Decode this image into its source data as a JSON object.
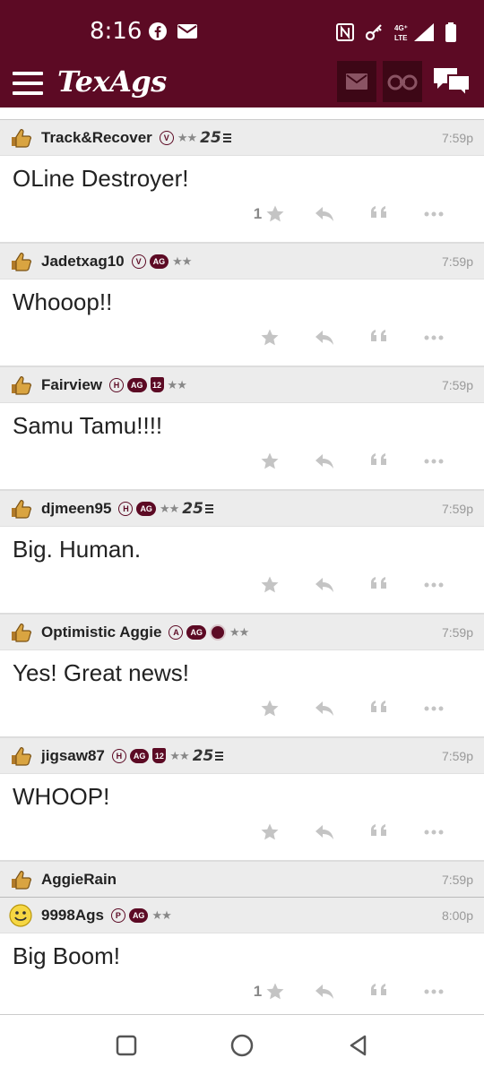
{
  "status_bar": {
    "time": "8:16",
    "left_icons": [
      "facebook-icon",
      "mail-icon"
    ],
    "right_icons": [
      "nfc-icon",
      "key-icon",
      "lte-signal-icon",
      "battery-icon"
    ],
    "network": "4G+ LTE"
  },
  "header": {
    "logo": "TexAgs",
    "mail_icon": "mail-icon",
    "binoculars_icon": "binoculars-icon",
    "chat_icon": "chat-bubbles-icon"
  },
  "colors": {
    "brand": "#5c0a24",
    "header_dark": "#3d0716",
    "icon_grey": "#c4c4c4"
  },
  "posts": [
    {
      "username": "Track&Recover",
      "badges": [
        "V",
        "stars",
        "25"
      ],
      "time": "7:59p",
      "text": "OLine Destroyer!",
      "star_count": "1",
      "avatar": "thumb-icon"
    },
    {
      "username": "Jadetxag10",
      "badges": [
        "V",
        "AG",
        "stars"
      ],
      "time": "7:59p",
      "text": "Whooop!!",
      "star_count": "",
      "avatar": "thumb-icon"
    },
    {
      "username": "Fairview",
      "badges": [
        "H",
        "AG",
        "12",
        "stars"
      ],
      "time": "7:59p",
      "text": "Samu Tamu!!!!",
      "star_count": "",
      "avatar": "thumb-icon"
    },
    {
      "username": "djmeen95",
      "badges": [
        "H",
        "AG",
        "stars",
        "25"
      ],
      "time": "7:59p",
      "text": "Big. Human.",
      "star_count": "",
      "avatar": "thumb-icon"
    },
    {
      "username": "Optimistic Aggie",
      "badges": [
        "A",
        "AG",
        "seal",
        "stars"
      ],
      "time": "7:59p",
      "text": "Yes! Great news!",
      "star_count": "",
      "avatar": "thumb-icon"
    },
    {
      "username": "jigsaw87",
      "badges": [
        "H",
        "AG",
        "12",
        "stars",
        "25"
      ],
      "time": "7:59p",
      "text": "WHOOP!",
      "star_count": "",
      "avatar": "thumb-icon"
    },
    {
      "username": "AggieRain",
      "badges": [],
      "time": "7:59p",
      "text": "",
      "star_count": "",
      "avatar": "thumb-icon"
    },
    {
      "username": "9998Ags",
      "badges": [
        "P",
        "AG",
        "stars"
      ],
      "time": "8:00p",
      "text": "Big Boom!",
      "star_count": "1",
      "avatar": "smiley-icon"
    }
  ],
  "badge_text": {
    "ag": "AG",
    "twelve": "12",
    "stars": "★★",
    "twenty_five": "25"
  },
  "bottom_nav": [
    "recents-square-icon",
    "home-circle-icon",
    "back-triangle-icon"
  ]
}
